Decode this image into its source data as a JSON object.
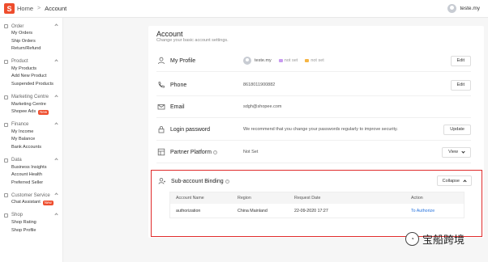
{
  "topbar": {
    "logo": "S",
    "home": "Home",
    "current": "Account",
    "username": "teste.my"
  },
  "sidebar": [
    {
      "title": "Order",
      "items": [
        {
          "label": "My Orders"
        },
        {
          "label": "Ship Orders"
        },
        {
          "label": "Return/Refund"
        }
      ]
    },
    {
      "title": "Product",
      "items": [
        {
          "label": "My Products"
        },
        {
          "label": "Add New Product"
        },
        {
          "label": "Suspended Products"
        }
      ]
    },
    {
      "title": "Marketing Centre",
      "items": [
        {
          "label": "Marketing Centre"
        },
        {
          "label": "Shopee Ads",
          "badge": "New"
        }
      ]
    },
    {
      "title": "Finance",
      "items": [
        {
          "label": "My Income"
        },
        {
          "label": "My Balance"
        },
        {
          "label": "Bank Accounts"
        }
      ]
    },
    {
      "title": "Data",
      "items": [
        {
          "label": "Business Insights"
        },
        {
          "label": "Account Health"
        },
        {
          "label": "Preferred Seller"
        }
      ]
    },
    {
      "title": "Customer Service",
      "items": [
        {
          "label": "Chat Assistant",
          "badge": "New"
        }
      ]
    },
    {
      "title": "Shop",
      "items": [
        {
          "label": "Shop Rating"
        },
        {
          "label": "Shop Profile"
        }
      ]
    }
  ],
  "account": {
    "title": "Account",
    "subtitle": "Change your basic account settings.",
    "profile": {
      "label": "My Profile",
      "name": "teste.my",
      "not_set_1": "not set",
      "not_set_2": "not set",
      "button": "Edit"
    },
    "phone": {
      "label": "Phone",
      "value": "8618011900882",
      "button": "Edit"
    },
    "email": {
      "label": "Email",
      "value": "sdgh@shopee.com"
    },
    "password": {
      "label": "Login password",
      "value": "We recommend that you change your passwords regularly to improve security.",
      "button": "Update"
    },
    "partner": {
      "label": "Partner Platform",
      "value": "Not Set",
      "button": "View"
    },
    "subaccount": {
      "label": "Sub-account Binding",
      "button": "Collapse",
      "columns": [
        "Account Name",
        "Region",
        "Request Date",
        "Action"
      ],
      "rows": [
        {
          "account": "authorization",
          "region": "China Mainland",
          "date": "22-09-2020 17:27",
          "action": "To Authorize"
        }
      ]
    }
  },
  "watermark": {
    "text": "宝船跨境"
  },
  "colors": {
    "brand": "#ee4d2d",
    "highlight_border": "#e02b2b",
    "link": "#2673dd"
  }
}
